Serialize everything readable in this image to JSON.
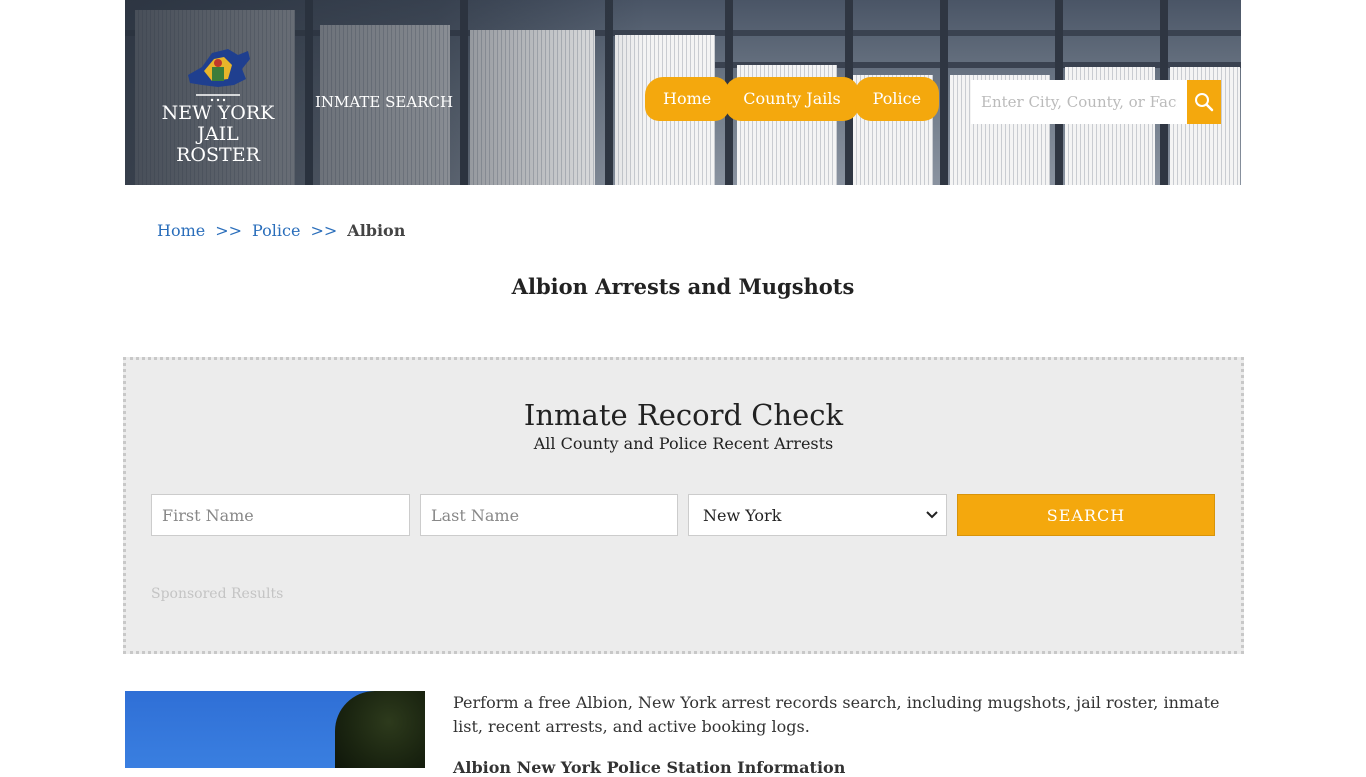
{
  "header": {
    "logo_line1": "NEW YORK",
    "logo_line2": "JAIL ROSTER",
    "inmate_search": "INMATE SEARCH",
    "nav": [
      {
        "label": "Home"
      },
      {
        "label": "County Jails"
      },
      {
        "label": "Police"
      }
    ],
    "search_placeholder": "Enter City, County, or Facility"
  },
  "breadcrumb": {
    "items": [
      "Home",
      "Police"
    ],
    "separator": ">>",
    "current": "Albion"
  },
  "page_title": "Albion Arrests and Mugshots",
  "record_check": {
    "title": "Inmate Record Check",
    "subtitle": "All County and Police Recent Arrests",
    "first_name_placeholder": "First Name",
    "last_name_placeholder": "Last Name",
    "state_selected": "New York",
    "search_button": "SEARCH",
    "sponsored": "Sponsored Results"
  },
  "content": {
    "intro": "Perform a free Albion, New York arrest records search, including mugshots, jail roster, inmate list, recent arrests, and active booking logs.",
    "subhead": "Albion New York Police Station Information"
  },
  "colors": {
    "accent": "#f4a80d",
    "link": "#2a6ebb",
    "panel": "#ececec"
  }
}
